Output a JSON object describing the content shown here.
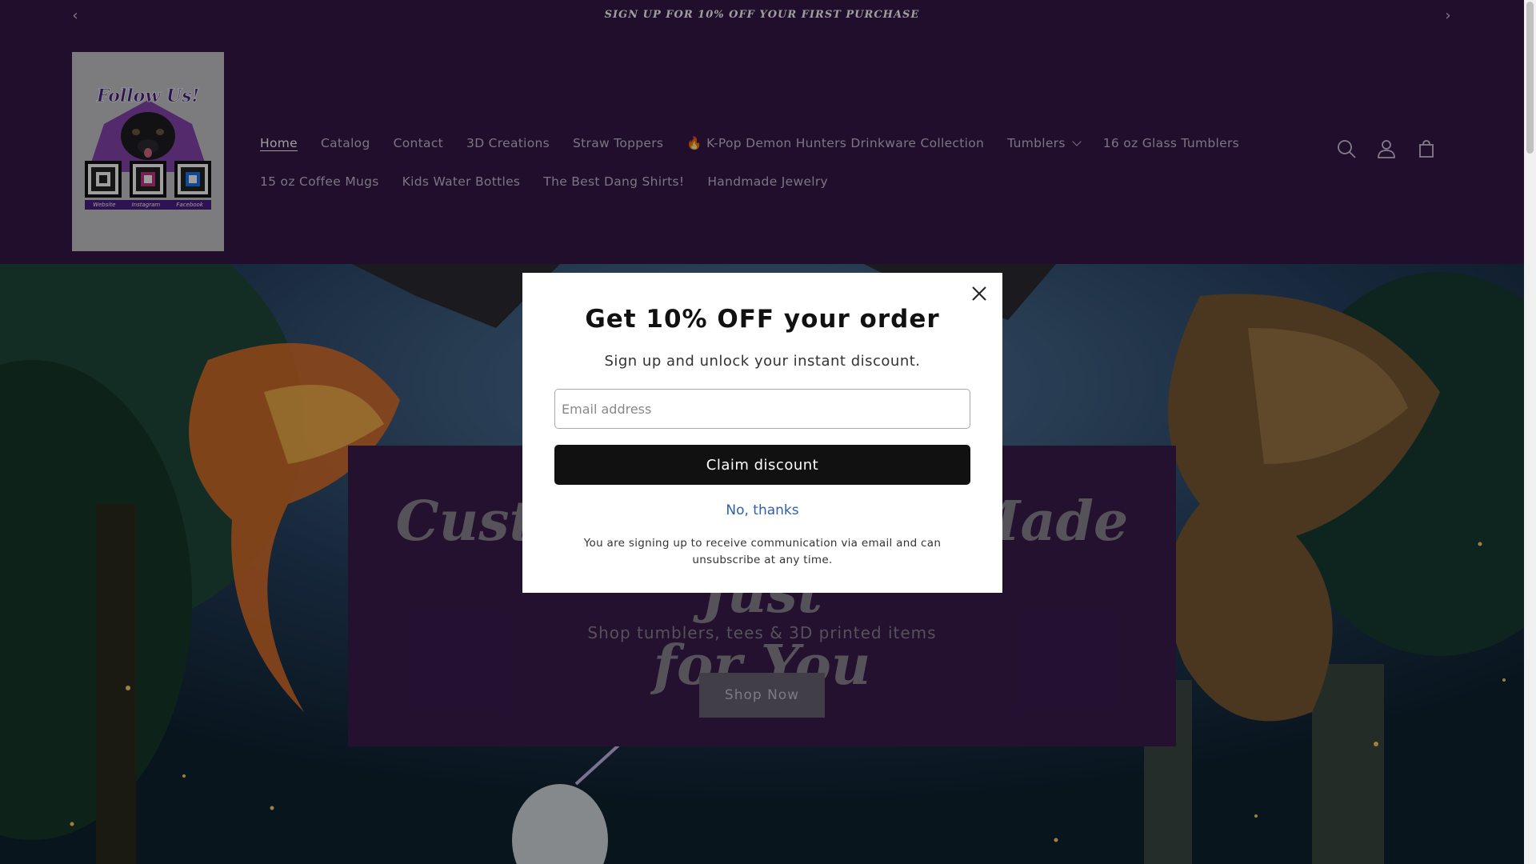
{
  "announcement": {
    "text": "SIGN UP FOR 10% OFF YOUR FIRST PURCHASE",
    "prev_icon": "chevron-left-icon",
    "next_icon": "chevron-right-icon"
  },
  "nav": {
    "row1": [
      {
        "label": "Home",
        "active": true
      },
      {
        "label": "Catalog"
      },
      {
        "label": "Contact"
      },
      {
        "label": "3D Creations"
      },
      {
        "label": "Straw Toppers"
      },
      {
        "label": "🔥 K-Pop Demon Hunters Drinkware Collection"
      },
      {
        "label": "Tumblers",
        "dropdown": true
      },
      {
        "label": "16 oz Glass Tumblers"
      }
    ],
    "row2": [
      {
        "label": "15 oz Coffee Mugs"
      },
      {
        "label": "Kids Water Bottles"
      },
      {
        "label": "The Best Dang Shirts!"
      },
      {
        "label": "Handmade Jewelry"
      }
    ]
  },
  "header_icons": [
    "search-icon",
    "account-icon",
    "cart-icon"
  ],
  "logo": {
    "title": "Follow Us!",
    "qr_labels": [
      "Website",
      "Instagram",
      "Facebook"
    ]
  },
  "hero": {
    "title_line1": "Custom Creations Made Just",
    "title_line2": "for You",
    "subtitle": "Shop tumblers, tees & 3D printed items",
    "button": "Shop Now"
  },
  "modal": {
    "title": "Get 10% OFF your order",
    "subtitle": "Sign up and unlock your instant discount.",
    "email_placeholder": "Email address",
    "claim_button": "Claim discount",
    "decline": "No, thanks",
    "legal": "You are signing up to receive communication via email and can unsubscribe at any time."
  },
  "colors": {
    "header_bg": "#351847",
    "hero_box_bg": "#3a1a4d",
    "modal_button": "#111111",
    "link_blue": "#2f5fae"
  }
}
